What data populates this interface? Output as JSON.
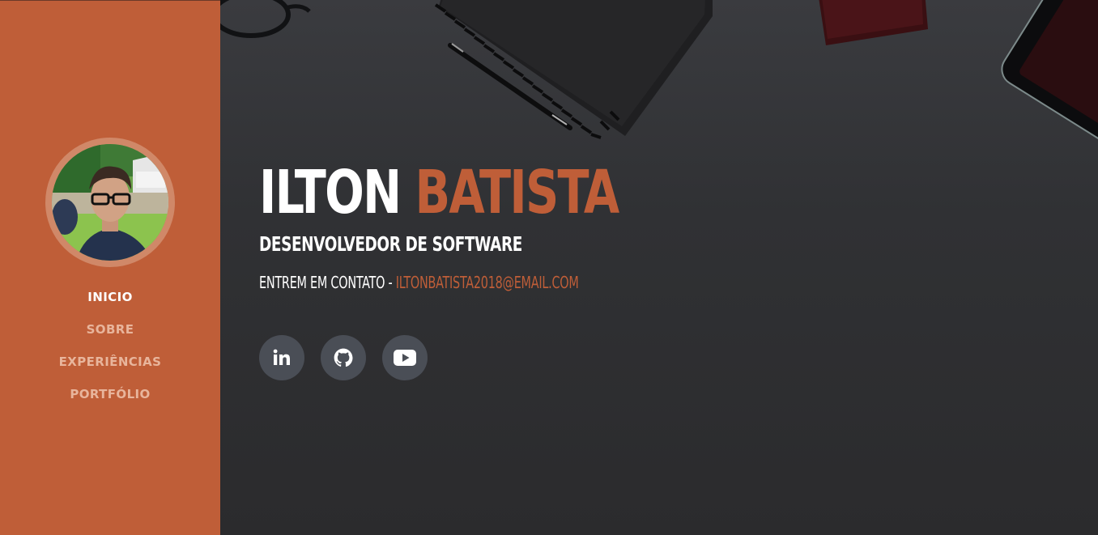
{
  "profile": {
    "first_name": "ILTON",
    "last_name": "BATISTA",
    "role": "DESENVOLVEDOR DE SOFTWARE",
    "contact_prefix": "ENTREM EM CONTATO - ",
    "email": "ILTONBATISTA2018@EMAIL.COM"
  },
  "nav": {
    "items": [
      {
        "label": "INICIO",
        "active": true
      },
      {
        "label": "SOBRE",
        "active": false
      },
      {
        "label": "EXPERIÊNCIAS",
        "active": false
      },
      {
        "label": "PORTFÓLIO",
        "active": false
      }
    ]
  },
  "socials": [
    {
      "icon": "linkedin-icon"
    },
    {
      "icon": "github-icon"
    },
    {
      "icon": "youtube-icon"
    }
  ],
  "colors": {
    "accent": "#bf5e38",
    "sidebar_bg": "#bf5e38",
    "hero_bg": "#2f3033",
    "social_bg": "#4a4e56",
    "nav_inactive": "#e8b59c",
    "text_light": "#ffffff"
  }
}
